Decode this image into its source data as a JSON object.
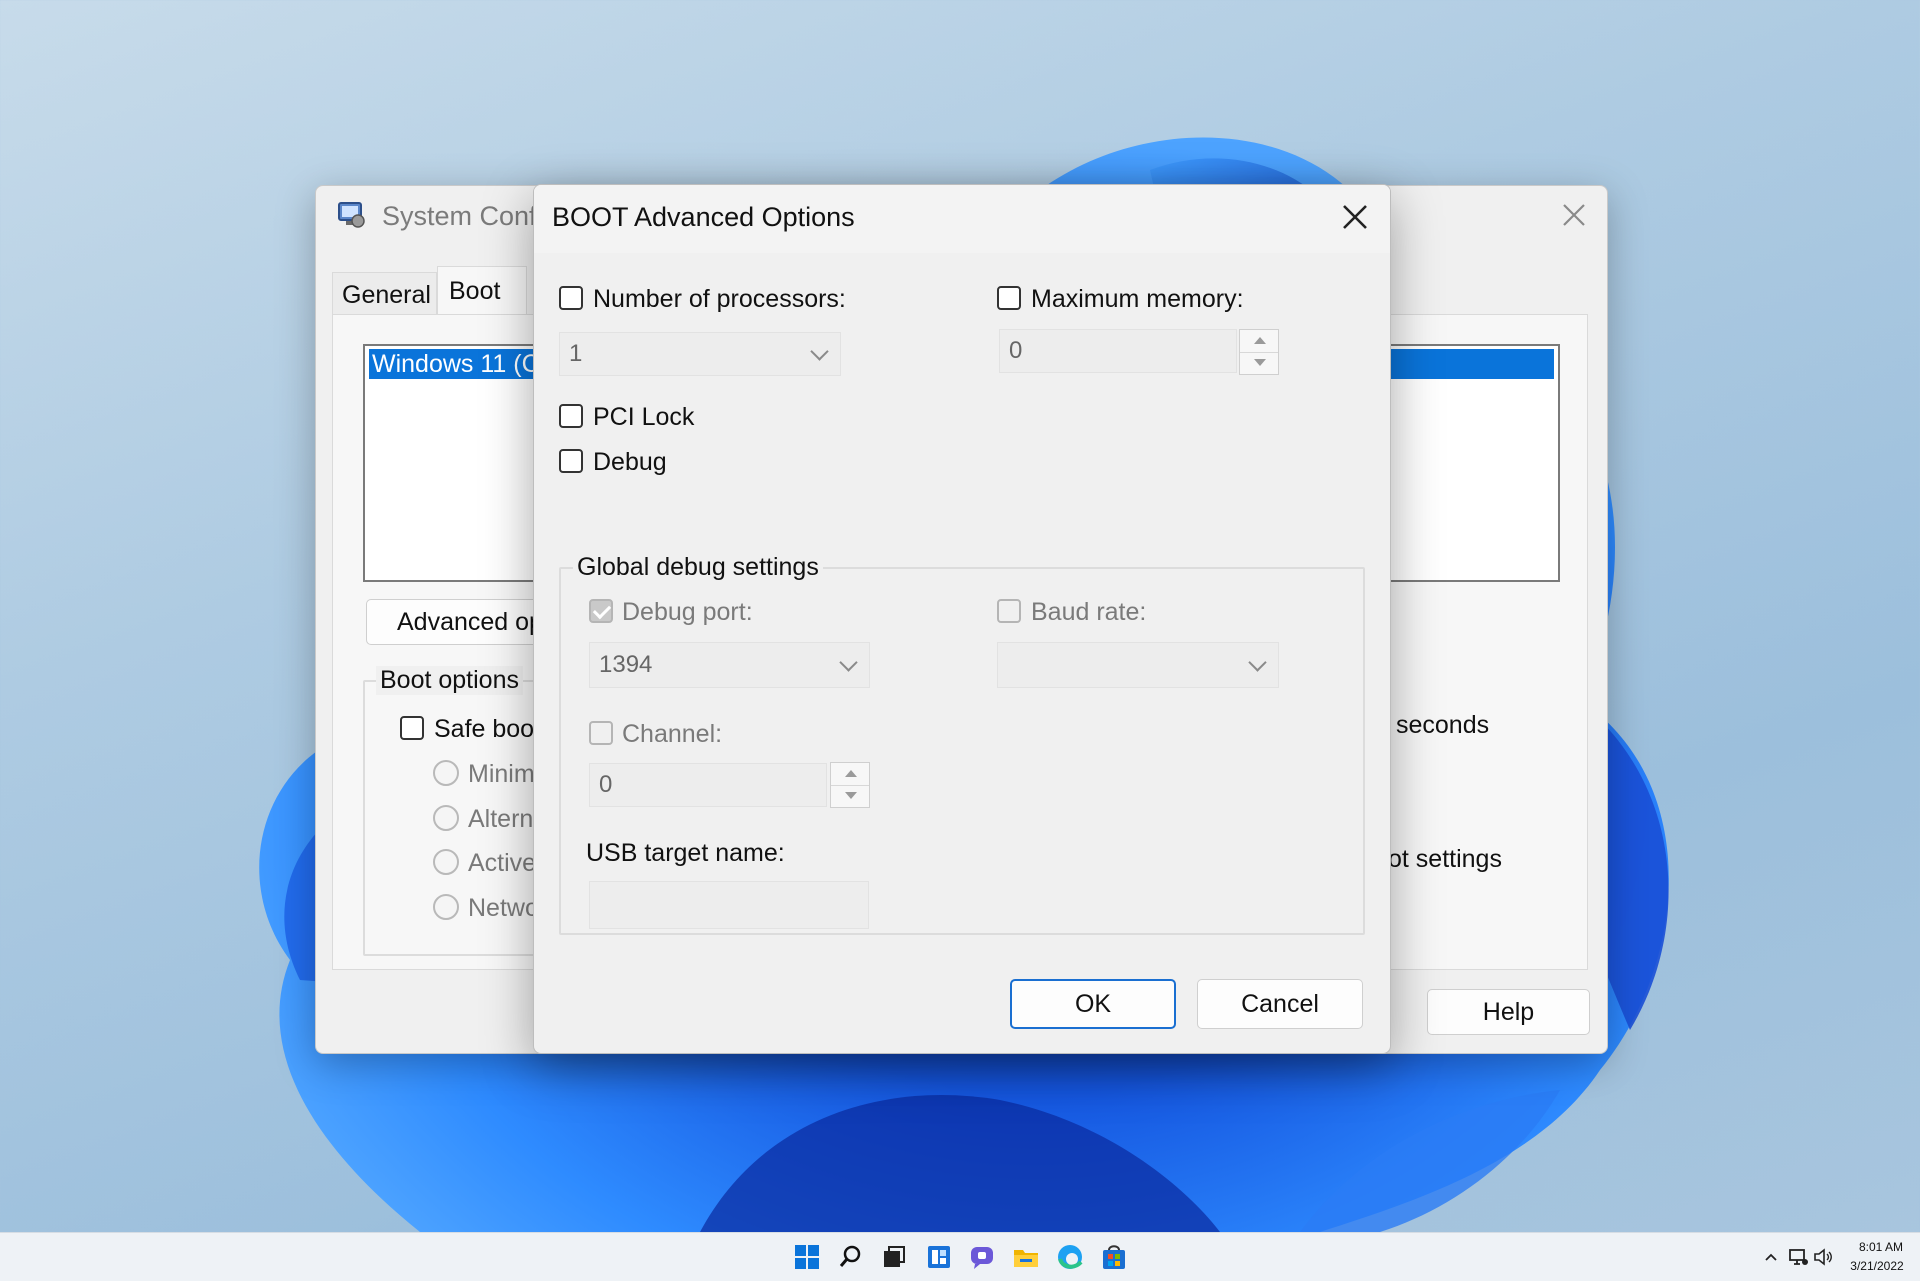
{
  "colors": {
    "accent": "#0078d7",
    "selection": "#0a74da",
    "bloom_dark": "#0a3cc0",
    "bloom_light": "#2d8cff"
  },
  "background_window": {
    "title": "System Conf",
    "icon": "system-config-icon",
    "tabs": [
      "General",
      "Boot"
    ],
    "os_list_item": "Windows 11 (C",
    "advanced_button": "Advanced op",
    "boot_options_group": "Boot options",
    "safe_boot_label": "Safe boo",
    "radio_options": [
      "Minima",
      "Altern",
      "Active",
      "Netwo"
    ],
    "seconds_label": "seconds",
    "boot_settings_label": "ot settings",
    "help_button": "Help"
  },
  "dialog": {
    "title": "BOOT Advanced Options",
    "number_of_processors": {
      "label": "Number of processors:",
      "checked": false,
      "value": "1"
    },
    "maximum_memory": {
      "label": "Maximum memory:",
      "checked": false,
      "value": "0"
    },
    "pci_lock": {
      "label": "PCI Lock",
      "checked": false
    },
    "debug": {
      "label": "Debug",
      "checked": false
    },
    "global_debug_settings": {
      "title": "Global debug settings",
      "debug_port": {
        "label": "Debug port:",
        "checked": true,
        "value": "1394"
      },
      "baud_rate": {
        "label": "Baud rate:",
        "checked": false,
        "value": ""
      },
      "channel": {
        "label": "Channel:",
        "checked": false,
        "value": "0"
      },
      "usb_target_name": {
        "label": "USB target name:",
        "value": ""
      }
    },
    "ok_button": "OK",
    "cancel_button": "Cancel"
  },
  "taskbar": {
    "icons": [
      "start-icon",
      "search-icon",
      "task-view-icon",
      "widgets-icon",
      "chat-icon",
      "file-explorer-icon",
      "edge-icon",
      "store-icon"
    ],
    "tray_icons": [
      "chevron-up-icon",
      "network-icon",
      "volume-icon"
    ],
    "time": "8:01 AM",
    "date": "3/21/2022"
  }
}
